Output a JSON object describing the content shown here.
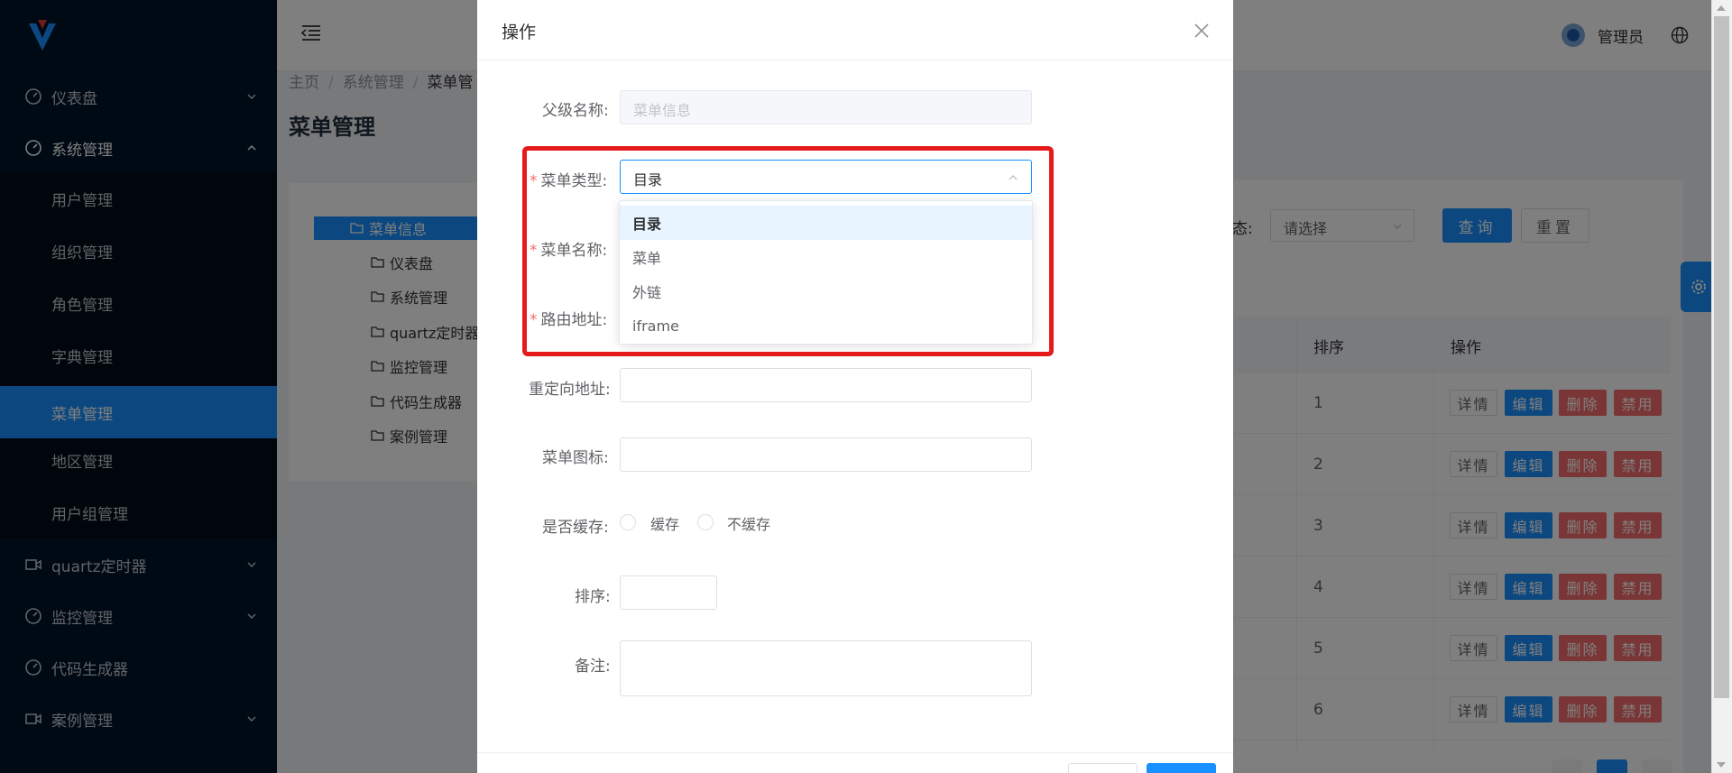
{
  "sidebar": {
    "menu": [
      {
        "label": "仪表盘"
      },
      {
        "label": "系统管理"
      },
      {
        "label": "quartz定时器"
      },
      {
        "label": "监控管理"
      },
      {
        "label": "代码生成器"
      },
      {
        "label": "案例管理"
      }
    ],
    "submenu": [
      {
        "label": "用户管理"
      },
      {
        "label": "组织管理"
      },
      {
        "label": "角色管理"
      },
      {
        "label": "字典管理"
      },
      {
        "label": "菜单管理"
      },
      {
        "label": "地区管理"
      },
      {
        "label": "用户组管理"
      }
    ]
  },
  "header": {
    "user": "管理员"
  },
  "breadcrumb": [
    "主页",
    "系统管理",
    "菜单管"
  ],
  "page_title": "菜单管理",
  "tree": {
    "root": "菜单信息",
    "children": [
      "仪表盘",
      "系统管理",
      "quartz定时器",
      "监控管理",
      "代码生成器",
      "案例管理"
    ]
  },
  "filter": {
    "label": "态:",
    "select_placeholder": "请选择",
    "query": "查询",
    "reset": "重置"
  },
  "table": {
    "headers": {
      "sort": "排序",
      "ops": "操作"
    },
    "rows": [
      {
        "sort": "1"
      },
      {
        "sort": "2"
      },
      {
        "sort": "3"
      },
      {
        "sort": "4"
      },
      {
        "sort": "5"
      },
      {
        "sort": "6"
      }
    ],
    "actions": {
      "detail": "详情",
      "edit": "编辑",
      "delete": "删除",
      "disable": "禁用"
    }
  },
  "dialog": {
    "title": "操作",
    "fields": {
      "parent_label": "父级名称:",
      "parent_value": "菜单信息",
      "type_label": "菜单类型:",
      "type_value": "目录",
      "name_label": "菜单名称:",
      "route_label": "路由地址:",
      "redirect_label": "重定向地址:",
      "icon_label": "菜单图标:",
      "cache_label": "是否缓存:",
      "cache_yes": "缓存",
      "cache_no": "不缓存",
      "sort_label": "排序:",
      "remark_label": "备注:"
    },
    "required_mark": "*",
    "type_options": [
      "目录",
      "菜单",
      "外链",
      "iframe"
    ]
  },
  "colors": {
    "primary": "#1890ff",
    "danger": "#f56c6c",
    "sidebar": "#001529",
    "highlight": "#e51b1b"
  }
}
